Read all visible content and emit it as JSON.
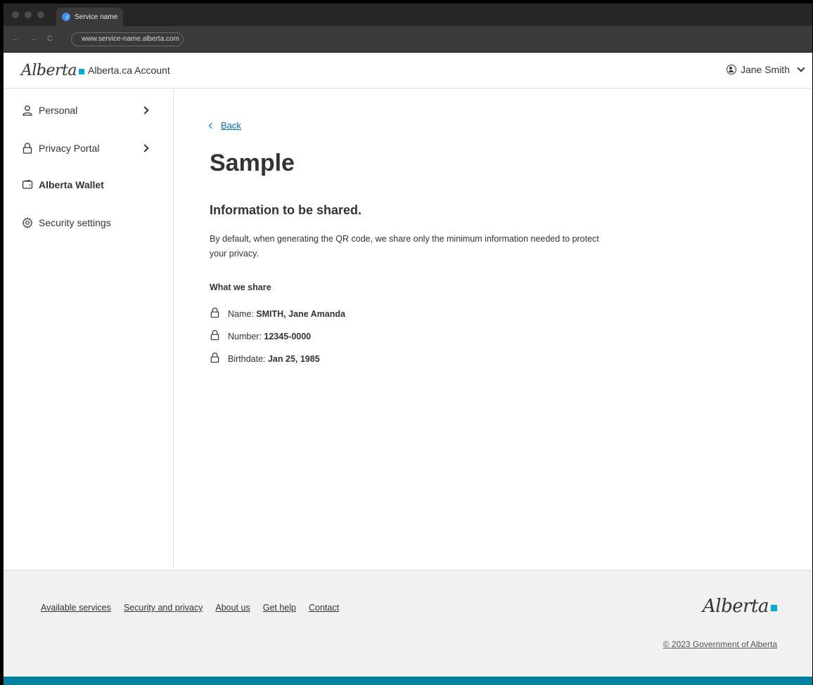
{
  "browser": {
    "tab_title": "Service name",
    "url": "www.service-name.alberta.com",
    "nav": {
      "back": "←",
      "forward": "→",
      "reload": "C"
    }
  },
  "header": {
    "logo_text": "Alberta",
    "title": "Alberta.ca Account",
    "user_name": "Jane Smith"
  },
  "sidebar": {
    "items": [
      {
        "label": "Personal",
        "icon": "person-icon",
        "has_chevron": true
      },
      {
        "label": "Privacy Portal",
        "icon": "lock-icon",
        "has_chevron": true
      },
      {
        "label": "Alberta Wallet",
        "icon": "wallet-icon",
        "active": true
      },
      {
        "label": "Security settings",
        "icon": "gear-icon"
      }
    ]
  },
  "main": {
    "back_label": "Back",
    "title": "Sample",
    "section_title": "Information to be shared.",
    "description": "By default, when generating the QR code, we share only the minimum information needed to protect your privacy.",
    "share_heading": "What we share",
    "share_items": [
      {
        "label": "Name: ",
        "value": "SMITH, Jane Amanda"
      },
      {
        "label": "Number: ",
        "value": "12345-0000"
      },
      {
        "label": "Birthdate: ",
        "value": "Jan 25, 1985"
      }
    ]
  },
  "footer": {
    "links": [
      "Available services",
      "Security and privacy",
      "About us",
      "Get help",
      "Contact"
    ],
    "logo_text": "Alberta",
    "copyright": "© 2023 Government of Alberta"
  },
  "colors": {
    "link": "#0070c4",
    "brand_square": "#00aad2",
    "bottom_bar": "#0081a2",
    "footer_bg": "#f1f1f1"
  }
}
